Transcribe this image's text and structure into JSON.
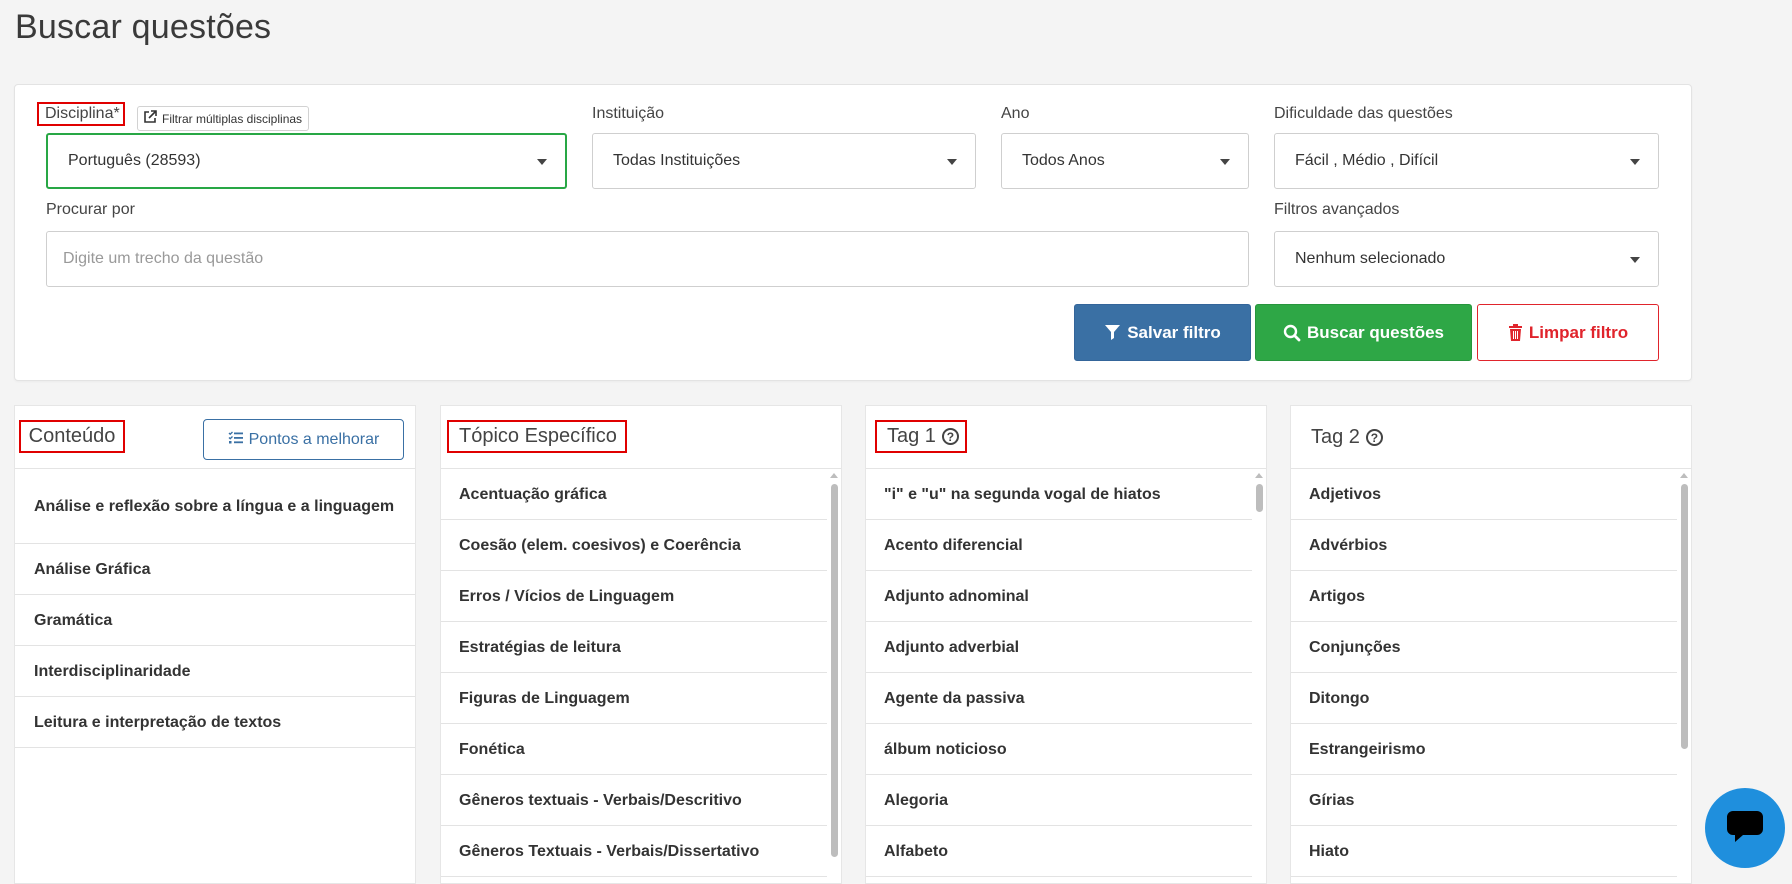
{
  "page": {
    "title": "Buscar questões"
  },
  "filters": {
    "disciplina": {
      "label": "Disciplina*",
      "multi_button": "Filtrar múltiplas disciplinas",
      "value": "Português (28593)"
    },
    "instituicao": {
      "label": "Instituição",
      "value": "Todas Instituições"
    },
    "ano": {
      "label": "Ano",
      "value": "Todos Anos"
    },
    "dificuldade": {
      "label": "Dificuldade das questões",
      "value": "Fácil , Médio , Difícil"
    },
    "procurar": {
      "label": "Procurar por",
      "placeholder": "Digite um trecho da questão",
      "value": ""
    },
    "avancados": {
      "label": "Filtros avançados",
      "value": "Nenhum selecionado"
    }
  },
  "buttons": {
    "salvar": "Salvar filtro",
    "buscar": "Buscar questões",
    "limpar": "Limpar filtro"
  },
  "panels": {
    "conteudo": {
      "title": "Conteúdo",
      "action": "Pontos a melhorar",
      "items": [
        "Análise e reflexão sobre a língua e a linguagem",
        "Análise Gráfica",
        "Gramática",
        "Interdisciplinaridade",
        "Leitura e interpretação de textos"
      ]
    },
    "topico": {
      "title": "Tópico Específico",
      "items": [
        "Acentuação gráfica",
        "Coesão (elem. coesivos) e Coerência",
        "Erros / Vícios de Linguagem",
        "Estratégias de leitura",
        "Figuras de Linguagem",
        "Fonética",
        "Gêneros textuais - Verbais/Descritivo",
        "Gêneros Textuais - Verbais/Dissertativo"
      ]
    },
    "tag1": {
      "title": "Tag 1",
      "items": [
        "\"i\" e \"u\" na segunda vogal de hiatos",
        "Acento diferencial",
        "Adjunto adnominal",
        "Adjunto adverbial",
        "Agente da passiva",
        "álbum noticioso",
        "Alegoria",
        "Alfabeto"
      ]
    },
    "tag2": {
      "title": "Tag 2",
      "items": [
        "Adjetivos",
        "Advérbios",
        "Artigos",
        "Conjunções",
        "Ditongo",
        "Estrangeirismo",
        "Gírias",
        "Hiato"
      ]
    }
  },
  "colors": {
    "primary": "#3a70a4",
    "success": "#2ea746",
    "danger": "#e0242c",
    "highlight": "#e00000",
    "chat": "#1f8fdd"
  },
  "icons": {
    "external_link": "external-link-icon",
    "filter": "filter-icon",
    "search": "search-icon",
    "trash": "trash-icon",
    "list_check": "list-check-icon",
    "help": "help-circle-icon",
    "chat": "chat-icon"
  }
}
